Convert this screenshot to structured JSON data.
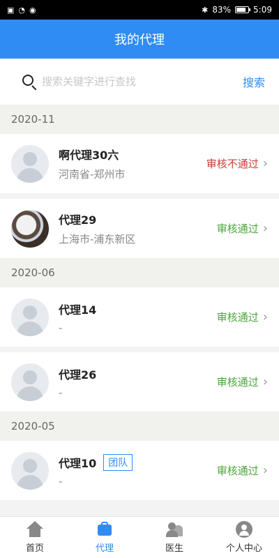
{
  "status_bar": {
    "battery": "83%",
    "battery_level": 0.83,
    "time": "5:09"
  },
  "header": {
    "title": "我的代理"
  },
  "search": {
    "placeholder": "搜索关键字进行查找",
    "button": "搜索"
  },
  "sections": [
    {
      "date": "2020-11",
      "items": [
        {
          "name": "啊代理30六",
          "region": "河南省-郑州市",
          "status": "审核不通过",
          "status_type": "fail",
          "avatar": "default"
        },
        {
          "name": "代理29",
          "region": "上海市-浦东新区",
          "status": "审核通过",
          "status_type": "pass",
          "avatar": "photo"
        }
      ]
    },
    {
      "date": "2020-06",
      "items": [
        {
          "name": "代理14",
          "region": "-",
          "status": "审核通过",
          "status_type": "pass",
          "avatar": "default"
        },
        {
          "name": "代理26",
          "region": "-",
          "status": "审核通过",
          "status_type": "pass",
          "avatar": "default"
        }
      ]
    },
    {
      "date": "2020-05",
      "items": [
        {
          "name": "代理10",
          "tag": "团队",
          "region": "-",
          "status": "审核通过",
          "status_type": "pass",
          "avatar": "default"
        }
      ]
    }
  ],
  "tabbar": {
    "tabs": [
      {
        "label": "首页",
        "icon": "home-icon"
      },
      {
        "label": "代理",
        "icon": "briefcase-icon"
      },
      {
        "label": "医生",
        "icon": "doctors-icon"
      },
      {
        "label": "个人中心",
        "icon": "profile-icon"
      }
    ],
    "active_index": 1
  },
  "colors": {
    "primary": "#2f8cf4",
    "pass": "#4aa63a",
    "fail": "#cc3b34"
  }
}
